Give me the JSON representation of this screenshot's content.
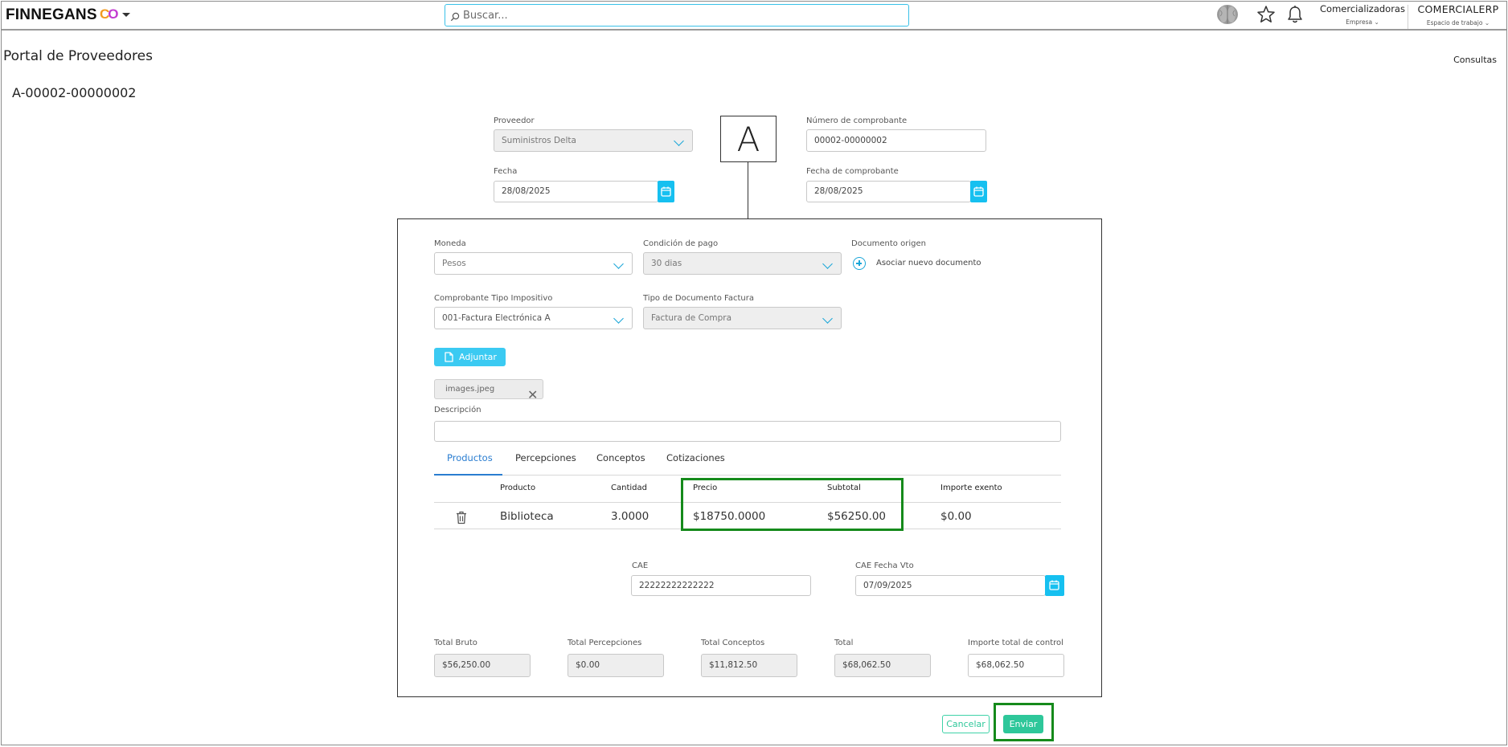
{
  "topbar": {
    "logo_text": "FINNEGANS",
    "logo_mark_1": "C",
    "logo_mark_2": "O",
    "search_placeholder": "Buscar...",
    "company": {
      "name": "Comercializadoras",
      "sub": "Empresa ⌄"
    },
    "workspace": {
      "name": "COMERCIALERP",
      "sub": "Espacio de trabajo ⌄"
    },
    "icons": [
      "brain-icon",
      "star-icon",
      "bell-icon"
    ]
  },
  "page": {
    "title": "Portal de Proveedores",
    "consultas": "Consultas",
    "doc_number": "A-00002-00000002",
    "letter": "A"
  },
  "header_form": {
    "proveedor": {
      "label": "Proveedor",
      "value": "Suministros Delta"
    },
    "numero": {
      "label": "Número de comprobante",
      "value": "00002-00000002"
    },
    "fecha": {
      "label": "Fecha",
      "value": "28/08/2025"
    },
    "fecha_comprobante": {
      "label": "Fecha de comprobante",
      "value": "28/08/2025"
    }
  },
  "details": {
    "moneda": {
      "label": "Moneda",
      "value": "Pesos"
    },
    "condicion_pago": {
      "label": "Condición de pago",
      "value": "30 dias"
    },
    "documento_origen": {
      "label": "Documento origen",
      "action": "Asociar nuevo documento"
    },
    "comprobante_tipo": {
      "label": "Comprobante Tipo Impositivo",
      "value": "001-Factura Electrónica A"
    },
    "tipo_documento": {
      "label": "Tipo de Documento Factura",
      "value": "Factura de Compra"
    },
    "adjuntar_label": "Adjuntar",
    "attached_file": "images.jpeg",
    "descripcion": {
      "label": "Descripción",
      "value": ""
    }
  },
  "tabs": [
    {
      "label": "Productos",
      "active": true
    },
    {
      "label": "Percepciones",
      "active": false
    },
    {
      "label": "Conceptos",
      "active": false
    },
    {
      "label": "Cotizaciones",
      "active": false
    }
  ],
  "products_table": {
    "columns": [
      "Producto",
      "Cantidad",
      "Precio",
      "Subtotal",
      "Importe exento"
    ],
    "rows": [
      {
        "producto": "Biblioteca",
        "cantidad": "3.0000",
        "precio": "$18750.0000",
        "subtotal": "$56250.00",
        "importe_exento": "$0.00"
      }
    ]
  },
  "cae": {
    "cae": {
      "label": "CAE",
      "value": "22222222222222"
    },
    "fecha_vto": {
      "label": "CAE Fecha Vto",
      "value": "07/09/2025"
    }
  },
  "totals": [
    {
      "label": "Total Bruto",
      "value": "$56,250.00"
    },
    {
      "label": "Total Percepciones",
      "value": "$0.00"
    },
    {
      "label": "Total Conceptos",
      "value": "$11,812.50"
    },
    {
      "label": "Total",
      "value": "$68,062.50"
    },
    {
      "label": "Importe total de control",
      "value": "$68,062.50"
    }
  ],
  "actions": {
    "cancel": "Cancelar",
    "send": "Enviar"
  },
  "colors": {
    "accent": "#16c0f0",
    "primary_action": "#2ec79a",
    "highlight": "#158a1b",
    "tab_active": "#2a7dd0"
  }
}
